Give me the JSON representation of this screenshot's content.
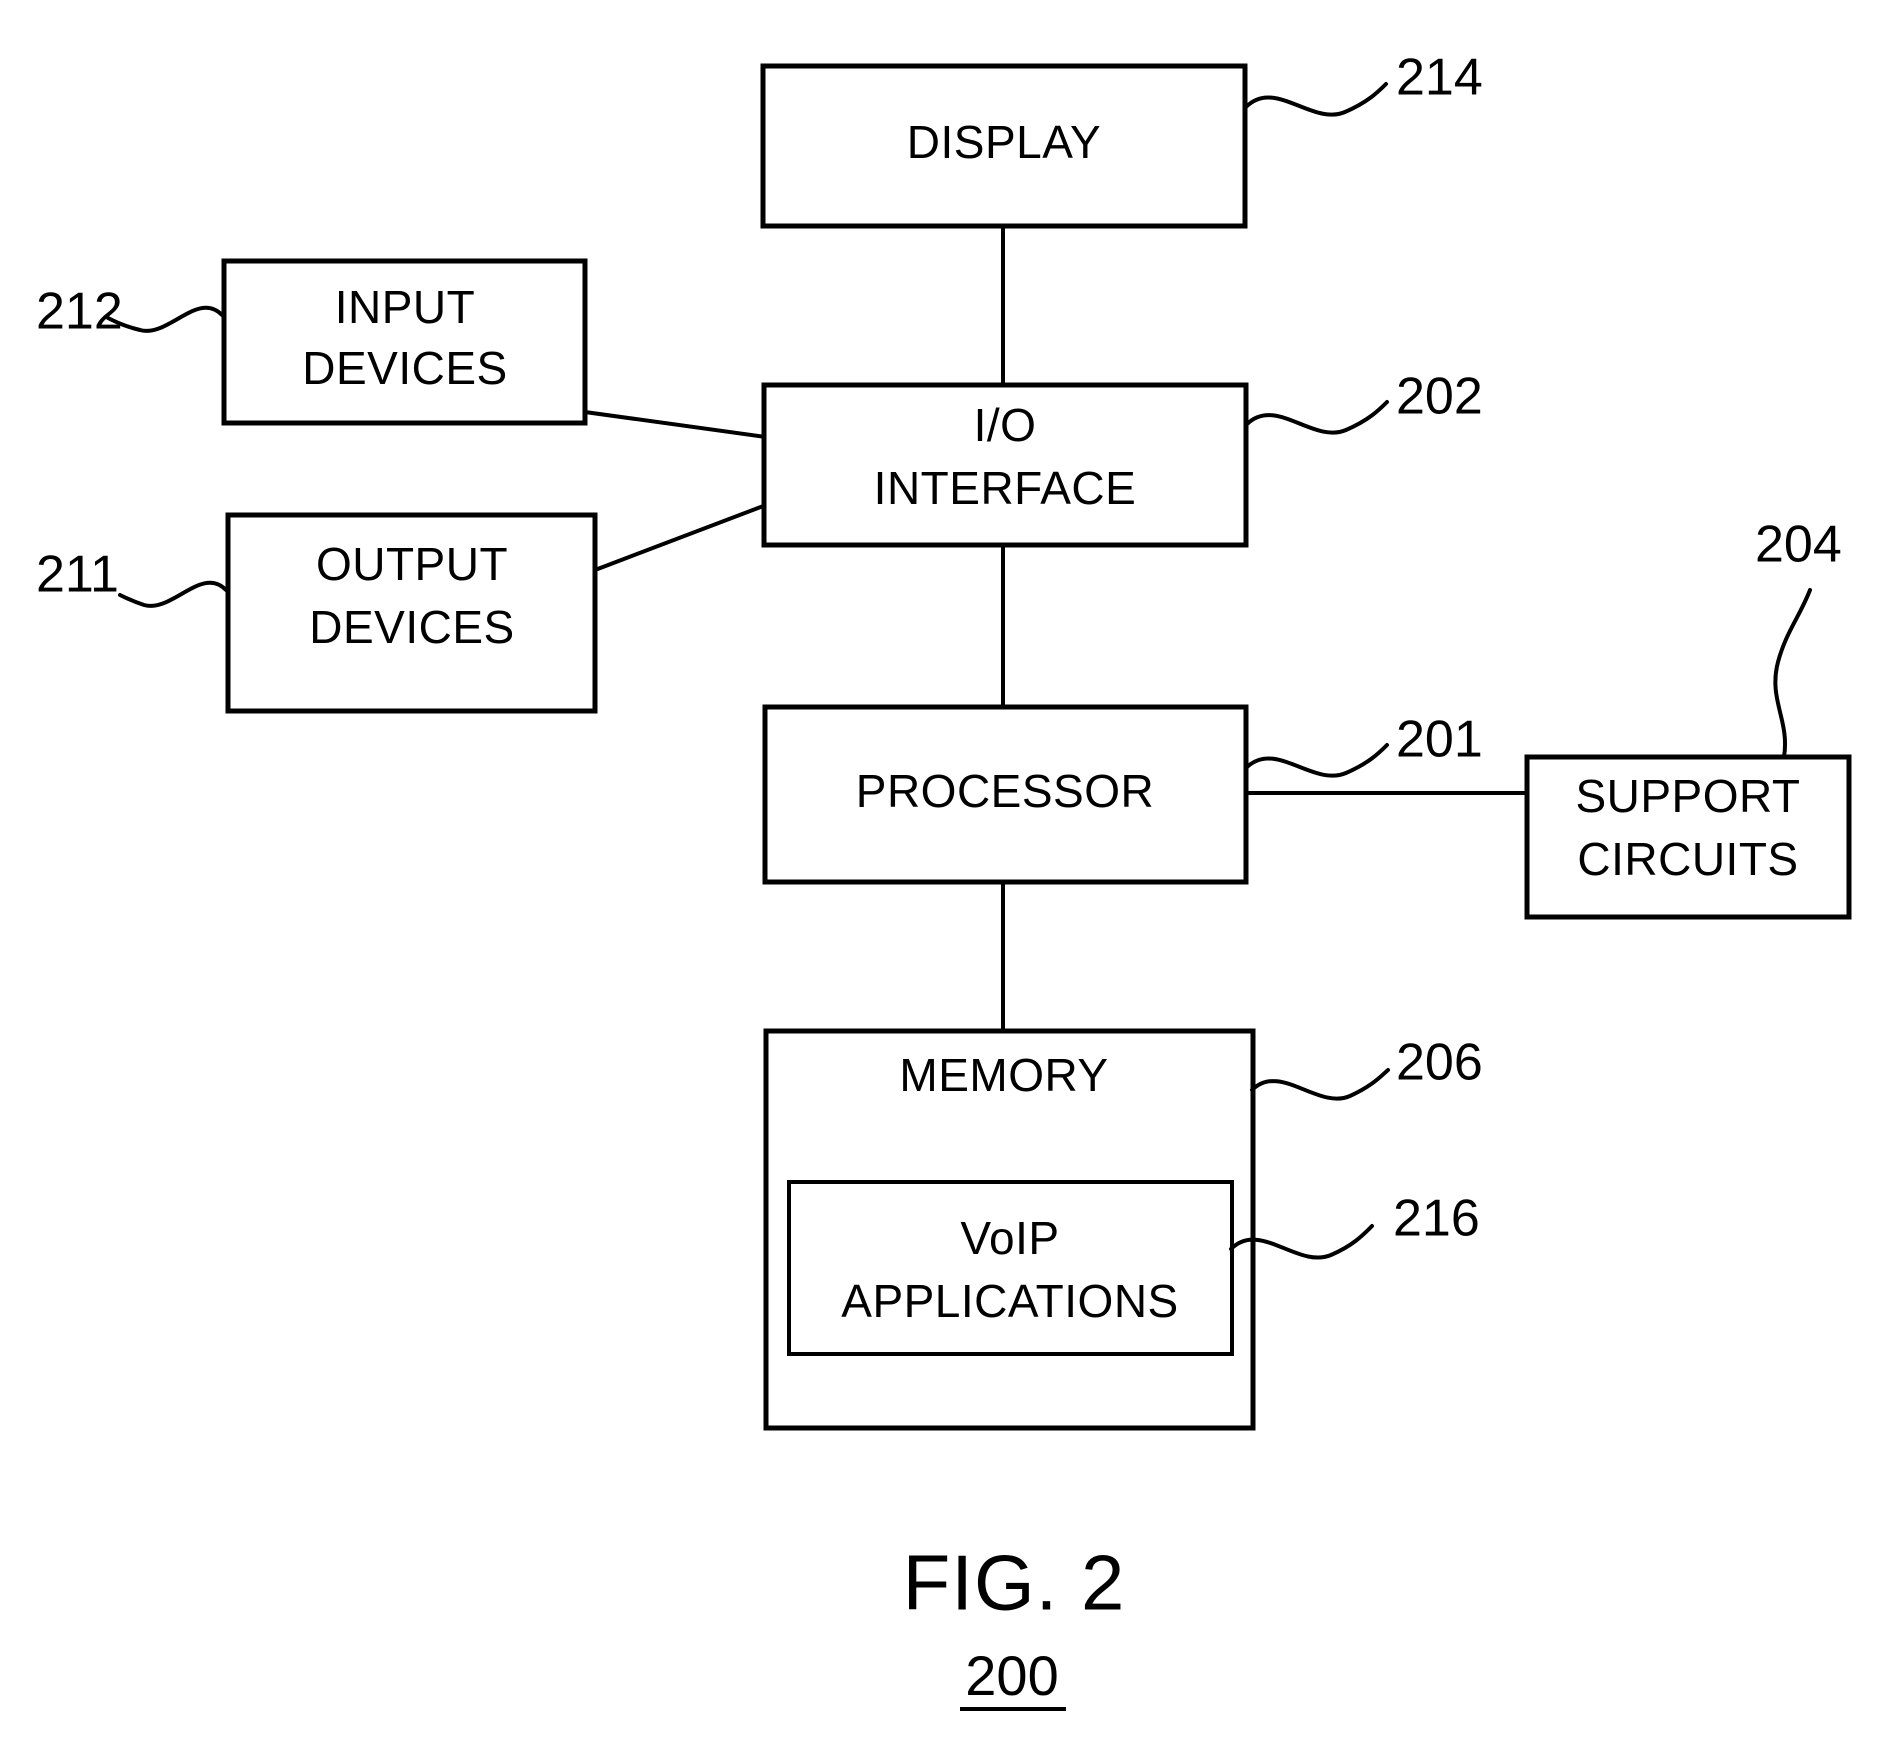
{
  "figure": {
    "title": "FIG. 2",
    "number": "200"
  },
  "blocks": [
    {
      "id": "display",
      "label_lines": [
        "DISPLAY"
      ],
      "ref": "214"
    },
    {
      "id": "input_devices",
      "label_lines": [
        "INPUT",
        "DEVICES"
      ],
      "ref": "212"
    },
    {
      "id": "output_devices",
      "label_lines": [
        "OUTPUT",
        "DEVICES"
      ],
      "ref": "211"
    },
    {
      "id": "io_interface",
      "label_lines": [
        "I/O",
        "INTERFACE"
      ],
      "ref": "202"
    },
    {
      "id": "processor",
      "label_lines": [
        "PROCESSOR"
      ],
      "ref": "201"
    },
    {
      "id": "support_circuits",
      "label_lines": [
        "SUPPORT",
        "CIRCUITS"
      ],
      "ref": "204"
    },
    {
      "id": "memory",
      "label_lines": [
        "MEMORY"
      ],
      "ref": "206"
    },
    {
      "id": "voip_apps",
      "label_lines": [
        "VoIP",
        "APPLICATIONS"
      ],
      "ref": "216"
    }
  ],
  "labels": {
    "display": "DISPLAY",
    "input_line1": "INPUT",
    "input_line2": "DEVICES",
    "output_line1": "OUTPUT",
    "output_line2": "DEVICES",
    "io_line1": "I/O",
    "io_line2": "INTERFACE",
    "processor": "PROCESSOR",
    "support_line1": "SUPPORT",
    "support_line2": "CIRCUITS",
    "memory": "MEMORY",
    "voip_line1": "VoIP",
    "voip_line2": "APPLICATIONS"
  },
  "refs": {
    "display": "214",
    "input_devices": "212",
    "output_devices": "211",
    "io_interface": "202",
    "processor": "201",
    "support_circuits": "204",
    "memory": "206",
    "voip_apps": "216"
  },
  "colors": {
    "ink": "#000000",
    "paper": "#ffffff"
  }
}
